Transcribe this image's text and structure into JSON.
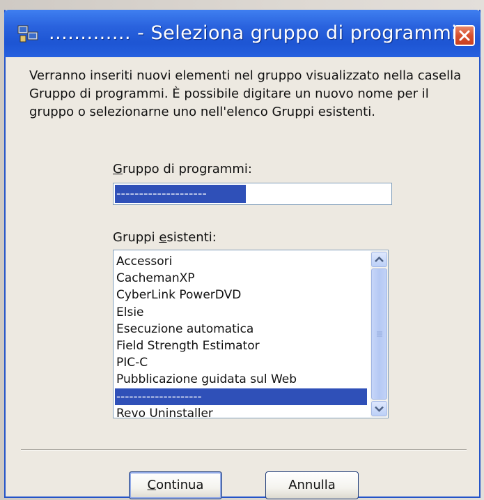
{
  "window": {
    "title": "............. - Seleziona gruppo di programmi",
    "close_icon": "close-icon",
    "app_icon": "program-group-icon"
  },
  "description": "Verranno inseriti nuovi elementi nel gruppo visualizzato nella casella Gruppo di programmi. È possibile digitare un nuovo nome per il gruppo o selezionarne uno nell'elenco Gruppi esistenti.",
  "group_field": {
    "label_prefix": "",
    "label_underlined": "G",
    "label_rest": "ruppo di programmi:",
    "value": "--------------------"
  },
  "existing_groups": {
    "label_prefix": "Gruppi ",
    "label_underlined": "e",
    "label_rest": "sistenti:",
    "items": [
      "Accessori",
      "CachemanXP",
      "CyberLink PowerDVD",
      "Elsie",
      "Esecuzione automatica",
      "Field Strength Estimator",
      "PIC-C",
      "Pubblicazione guidata sul Web",
      "--------------------",
      "Revo Uninstaller"
    ],
    "selected_index": 8
  },
  "buttons": {
    "continue_prefix": "",
    "continue_underlined": "C",
    "continue_rest": "ontinua",
    "cancel": "Annulla"
  },
  "colors": {
    "titlebar": "#2a63de",
    "selection": "#2f50b8",
    "close": "#d8502e"
  }
}
